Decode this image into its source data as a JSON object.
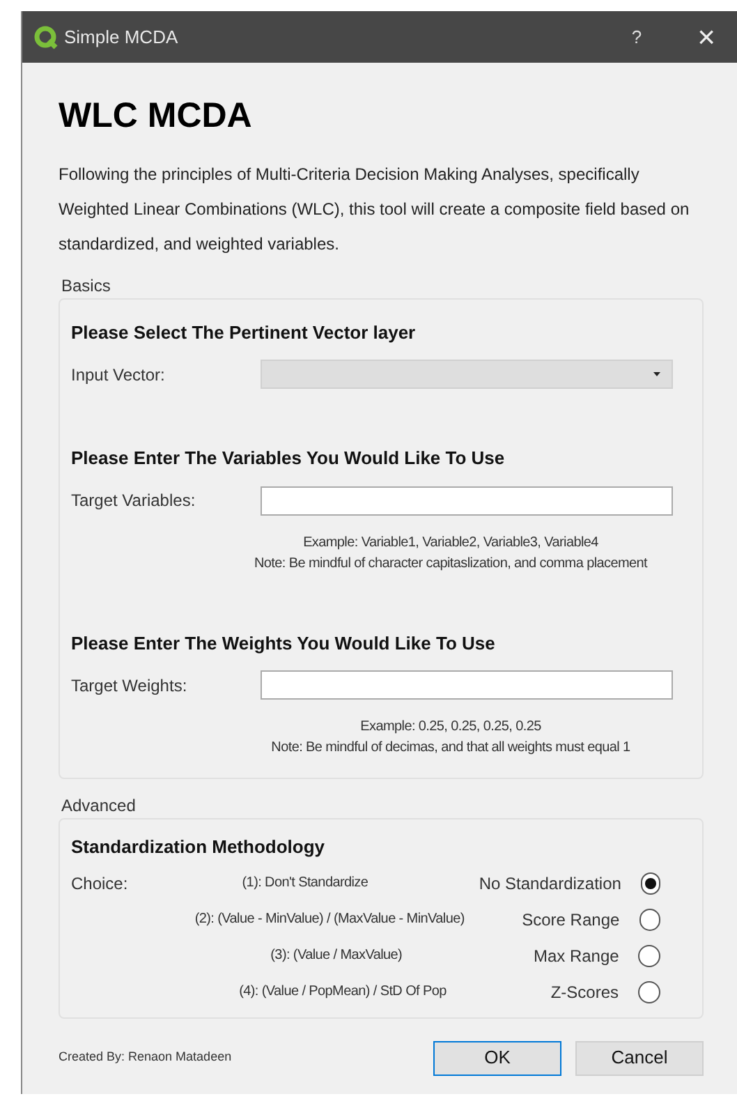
{
  "window": {
    "title": "Simple MCDA",
    "help": "?",
    "close": "×"
  },
  "heading": "WLC MCDA",
  "description": "Following the principles of Multi-Criteria Decision Making Analyses, specifically Weighted Linear Combinations (WLC), this tool will create a composite field based on standardized, and weighted variables.",
  "basics": {
    "title": "Basics",
    "sections": [
      {
        "kind": "dropdown",
        "heading": "Please Select The Pertinent Vector layer",
        "label": "Input Vector:"
      },
      {
        "kind": "text",
        "heading": "Please Enter The Variables You Would Like To Use",
        "label": "Target Variables:",
        "notes": [
          "Example: Variable1, Variable2, Variable3, Variable4",
          "Note: Be mindful of character capitaslization, and comma placement"
        ]
      },
      {
        "kind": "text",
        "heading": "Please Enter The Weights You Would Like To Use",
        "label": "Target Weights:",
        "notes": [
          "Example: 0.25, 0.25, 0.25, 0.25",
          "Note: Be mindful of decimas, and that all weights must equal 1"
        ]
      }
    ]
  },
  "advanced": {
    "title": "Advanced",
    "heading": "Standardization Methodology",
    "choice_label": "Choice:",
    "options": [
      {
        "formula": "(1): Don't Standardize",
        "label": "No Standardization",
        "selected": true
      },
      {
        "formula": "(2): (Value - MinValue) / (MaxValue - MinValue)",
        "label": "Score Range",
        "selected": false
      },
      {
        "formula": "(3): (Value / MaxValue)",
        "label": "Max Range",
        "selected": false
      },
      {
        "formula": "(4): (Value / PopMean) / StD Of Pop",
        "label": "Z-Scores",
        "selected": false
      }
    ]
  },
  "footer": {
    "credit": "Created By: Renaon Matadeen",
    "buttons": [
      {
        "label": "OK",
        "default": true
      },
      {
        "label": "Cancel",
        "default": false
      }
    ]
  }
}
